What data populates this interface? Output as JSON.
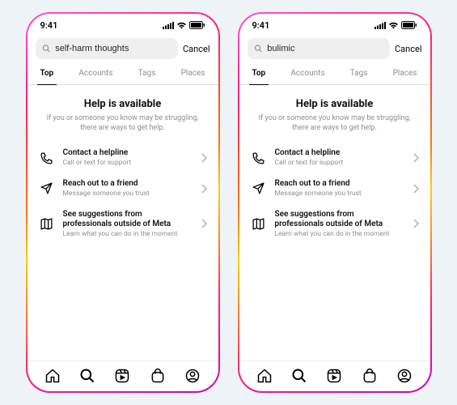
{
  "phones": [
    {
      "status_time": "9:41",
      "search_value": "self-harm thoughts",
      "cancel_label": "Cancel",
      "tabs": [
        "Top",
        "Accounts",
        "Tags",
        "Places"
      ],
      "active_tab": 0,
      "help_title": "Help is available",
      "help_sub_l1": "If you or someone you know may be struggling,",
      "help_sub_l2": "there are ways to get help.",
      "options": [
        {
          "icon": "phone",
          "title": "Contact a helpline",
          "sub": "Call or text for support"
        },
        {
          "icon": "send",
          "title": "Reach out to a friend",
          "sub": "Message someone you trust"
        },
        {
          "icon": "map",
          "title": "See suggestions from professionals outside of Meta",
          "sub": "Learn what you can do in the moment"
        }
      ]
    },
    {
      "status_time": "9:41",
      "search_value": "bulimic",
      "cancel_label": "Cancel",
      "tabs": [
        "Top",
        "Accounts",
        "Tags",
        "Places"
      ],
      "active_tab": 0,
      "help_title": "Help is available",
      "help_sub_l1": "If you or someone you know may be struggling,",
      "help_sub_l2": "there are ways to get help.",
      "options": [
        {
          "icon": "phone",
          "title": "Contact a helpline",
          "sub": "Call or text for support"
        },
        {
          "icon": "send",
          "title": "Reach out to a friend",
          "sub": "Message someone you trust"
        },
        {
          "icon": "map",
          "title": "See suggestions from professionals outside of Meta",
          "sub": "Learn what you can do in the moment"
        }
      ]
    }
  ]
}
